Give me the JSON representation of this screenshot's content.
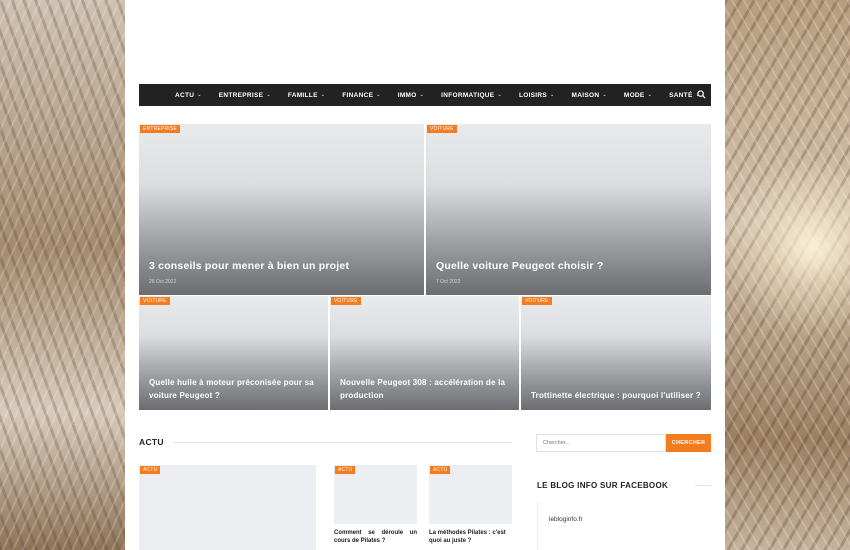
{
  "nav": {
    "items": [
      {
        "label": "ACTU"
      },
      {
        "label": "ENTREPRISE"
      },
      {
        "label": "FAMILLE"
      },
      {
        "label": "FINANCE"
      },
      {
        "label": "IMMO"
      },
      {
        "label": "INFORMATIQUE"
      },
      {
        "label": "LOISIRS"
      },
      {
        "label": "MAISON"
      },
      {
        "label": "MODE"
      },
      {
        "label": "SANTÉ"
      }
    ]
  },
  "featured": [
    {
      "tag": "Entreprise",
      "title": "3 conseils pour mener à bien un projet",
      "date": "26 Oct 2022"
    },
    {
      "tag": "Voiture",
      "title": "Quelle voiture Peugeot choisir ?",
      "date": "7 Oct 2022"
    },
    {
      "tag": "Voiture",
      "title": "Quelle huile à moteur préconisée pour sa voiture Peugeot ?"
    },
    {
      "tag": "Voiture",
      "title": "Nouvelle Peugeot 308 : accélération de la production"
    },
    {
      "tag": "Voiture",
      "title": "Trottinette électrique : pourquoi l'utiliser ?"
    }
  ],
  "section": {
    "title": "ACTU",
    "posts": [
      {
        "tag": "Actu",
        "title": ""
      },
      {
        "tag": "Actu",
        "title": "Comment se déroule un cours de Pilates ?"
      },
      {
        "tag": "Actu",
        "title": "La méthodes Pilates : c'est quoi au juste ?"
      }
    ]
  },
  "sidebar": {
    "search_placeholder": "Chercher...",
    "search_button": "CHERCHER",
    "widget_title": "LE BLOG INFO SUR FACEBOOK",
    "facebook_page": "lebloginfo.fr"
  },
  "colors": {
    "accent": "#f47c20",
    "nav_bg": "#222222"
  }
}
